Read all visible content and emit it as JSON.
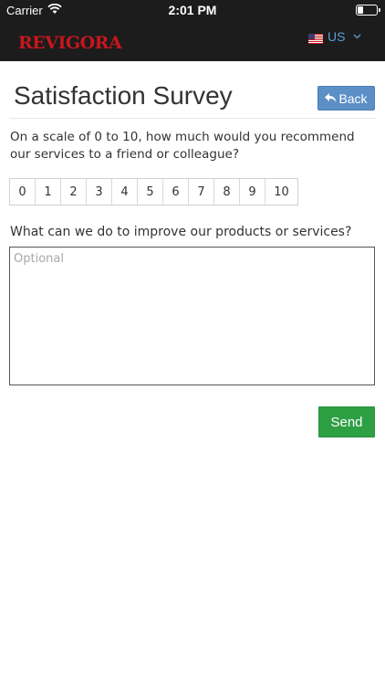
{
  "status_bar": {
    "carrier": "Carrier",
    "time": "2:01 PM",
    "battery_level": 0.35
  },
  "navbar": {
    "logo_text": "REVIGORA",
    "region_label": "US"
  },
  "page": {
    "title": "Satisfaction Survey",
    "back_label": "Back"
  },
  "survey": {
    "recommend_question": "On a scale of 0 to 10, how much would you recommend our services to a friend or colleague?",
    "scale_options": [
      "0",
      "1",
      "2",
      "3",
      "4",
      "5",
      "6",
      "7",
      "8",
      "9",
      "10"
    ],
    "improve_question": "What can we do to improve our products or services?",
    "feedback_placeholder": "Optional",
    "feedback_value": "",
    "send_label": "Send"
  },
  "colors": {
    "navbar_bg": "#1c1c1c",
    "logo_red": "#c8161d",
    "link_blue": "#5a9fd4",
    "back_button": "#5b8fc6",
    "send_button": "#2ea044"
  },
  "icons": {
    "wifi": "wifi-icon",
    "battery": "battery-icon",
    "flag": "us-flag-icon",
    "chevron": "chevron-down-icon",
    "back": "reply-arrow-icon"
  }
}
